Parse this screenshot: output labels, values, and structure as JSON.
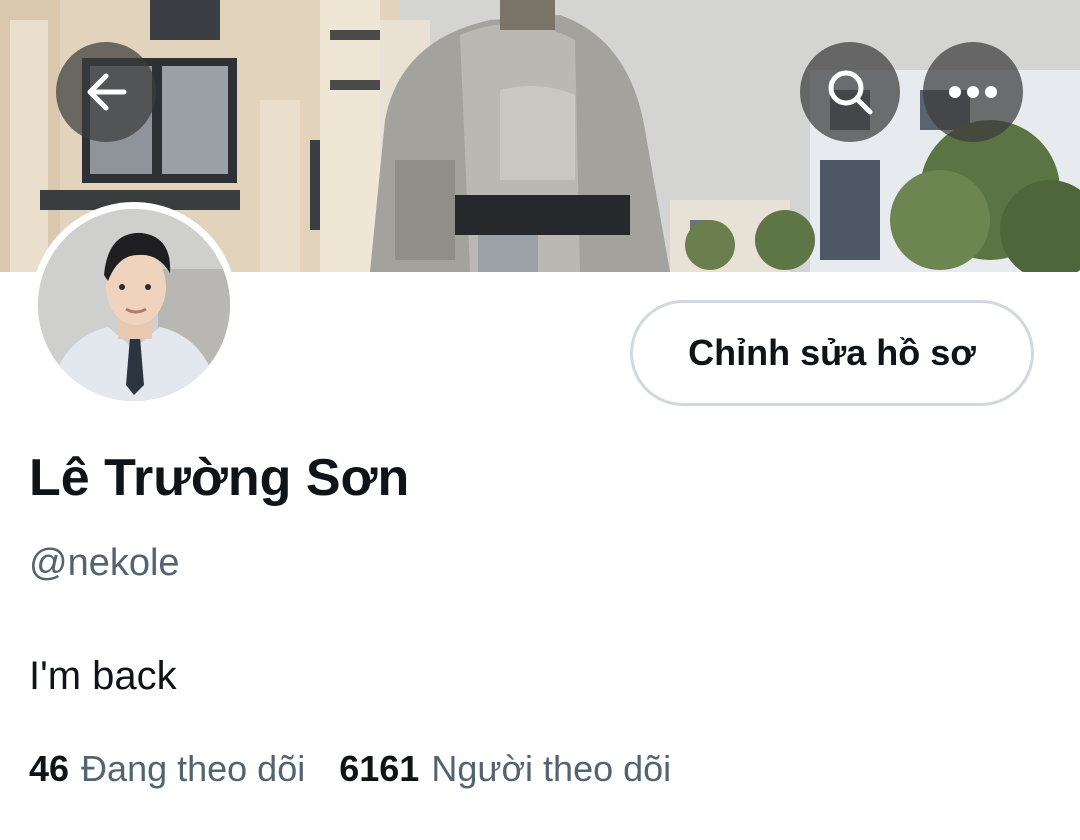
{
  "header": {
    "back_icon": "arrow-left-icon",
    "search_icon": "search-icon",
    "more_icon": "more-horizontal-icon"
  },
  "profile": {
    "display_name": "Lê Trường Sơn",
    "handle": "@nekole",
    "bio": "I'm back",
    "edit_button_label": "Chỉnh sửa hồ sơ"
  },
  "stats": {
    "following_count": "46",
    "following_label": "Đang theo dõi",
    "followers_count": "6161",
    "followers_label": "Người theo dõi"
  },
  "colors": {
    "primary_text": "#0f1419",
    "secondary_text": "#536471",
    "button_border": "#cfd9de",
    "overlay_button": "#3c3c3c"
  }
}
